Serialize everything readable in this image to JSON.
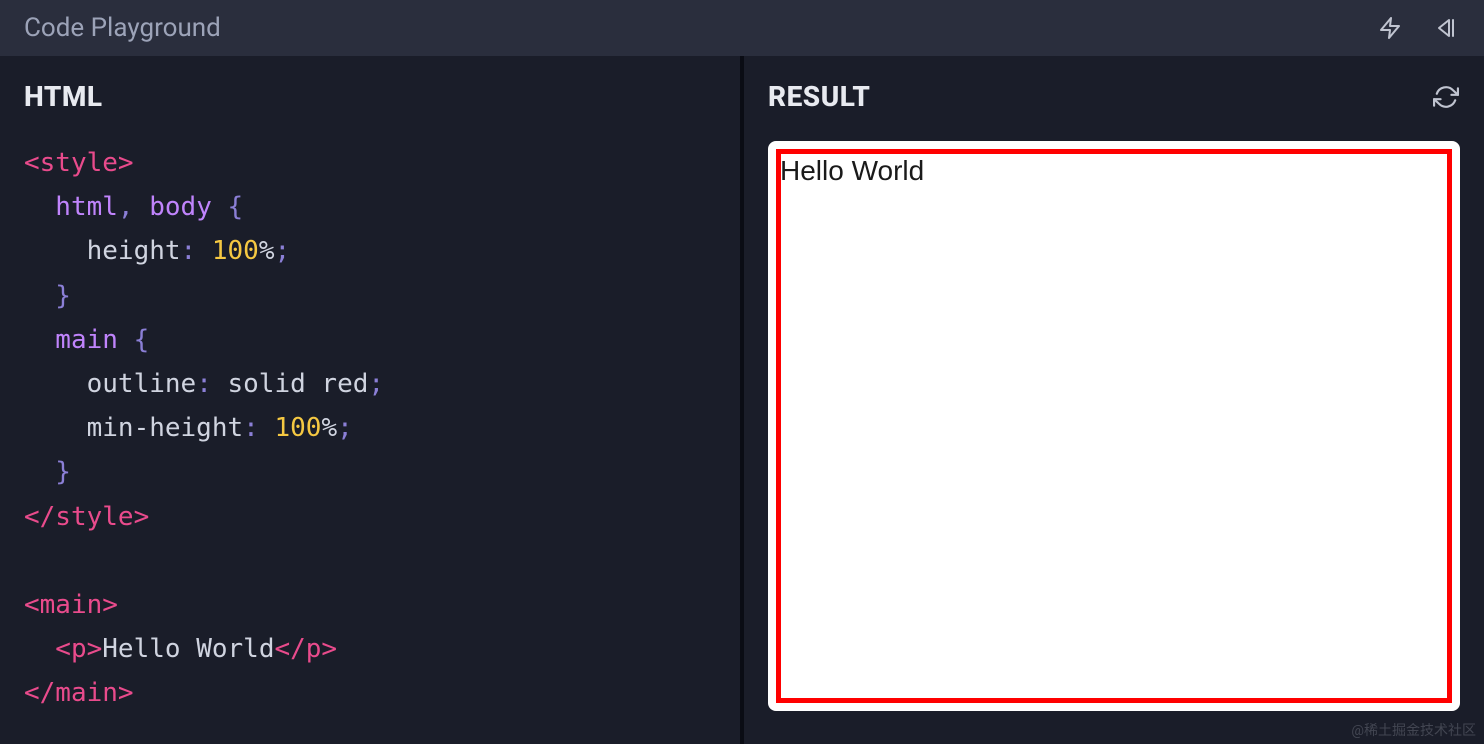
{
  "header": {
    "title": "Code Playground"
  },
  "panels": {
    "left_title": "HTML",
    "right_title": "RESULT"
  },
  "code": {
    "line1_open": "<style>",
    "line2_sel": "  html",
    "line2_comma": ", ",
    "line2_sel2": "body ",
    "line2_brace": "{",
    "line3_prop": "    height",
    "line3_colon": ": ",
    "line3_num": "100",
    "line3_pct": "%",
    "line3_semi": ";",
    "line4_brace": "  }",
    "line5_sel": "  main ",
    "line5_brace": "{",
    "line6_prop": "    outline",
    "line6_colon": ": ",
    "line6_val": "solid red",
    "line6_semi": ";",
    "line7_prop": "    min-height",
    "line7_colon": ": ",
    "line7_num": "100",
    "line7_pct": "%",
    "line7_semi": ";",
    "line8_brace": "  }",
    "line9_close": "</style>",
    "line11_open": "<main>",
    "line12_ptag_open": "  <p>",
    "line12_text": "Hello World",
    "line12_ptag_close": "</p>",
    "line13_close": "</main>"
  },
  "result": {
    "text": "Hello World"
  },
  "watermark": "@稀土掘金技术社区"
}
